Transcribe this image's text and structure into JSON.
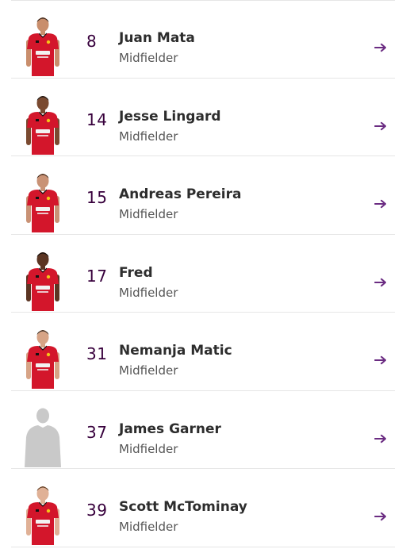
{
  "colors": {
    "accent": "#37003c",
    "kit_red": "#d3162b",
    "divider": "#e6e6e6"
  },
  "players": [
    {
      "number": "8",
      "name": "Juan Mata",
      "position": "Midfielder",
      "photo": "kit",
      "skin": "#c98e6c",
      "hair": "#2a1a12"
    },
    {
      "number": "14",
      "name": "Jesse Lingard",
      "position": "Midfielder",
      "photo": "kit",
      "skin": "#7a4a30",
      "hair": "#111111"
    },
    {
      "number": "15",
      "name": "Andreas Pereira",
      "position": "Midfielder",
      "photo": "kit",
      "skin": "#c99275",
      "hair": "#3a2516"
    },
    {
      "number": "17",
      "name": "Fred",
      "position": "Midfielder",
      "photo": "kit",
      "skin": "#5b3523",
      "hair": "#0e0a08"
    },
    {
      "number": "31",
      "name": "Nemanja Matic",
      "position": "Midfielder",
      "photo": "kit",
      "skin": "#d7a486",
      "hair": "#2f241c"
    },
    {
      "number": "37",
      "name": "James Garner",
      "position": "Midfielder",
      "photo": "silhouette"
    },
    {
      "number": "39",
      "name": "Scott McTominay",
      "position": "Midfielder",
      "photo": "kit",
      "skin": "#e0b196",
      "hair": "#5a3a22"
    }
  ],
  "icons": {
    "row_action": "arrow-right-icon",
    "placeholder": "player-silhouette-icon"
  }
}
